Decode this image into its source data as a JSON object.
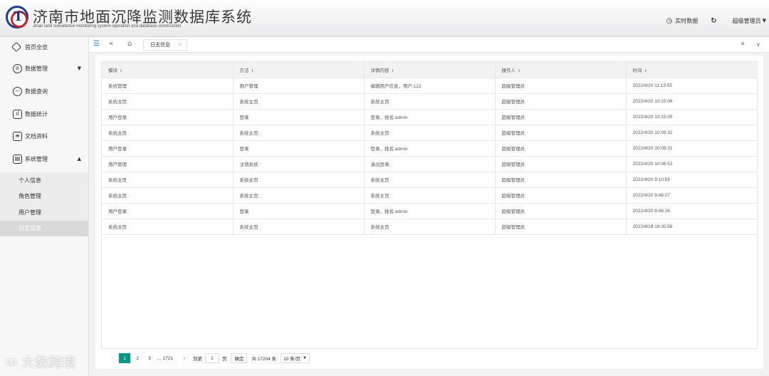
{
  "header": {
    "title": "济南市地面沉降监测数据库系统",
    "subtitle": "Jinan land subsidence monitoring system operation and database construction",
    "realtime_label": "实时数据",
    "user_label": "超级管理员"
  },
  "sidebar": {
    "items": [
      {
        "label": "首页全览",
        "icon": "cube-icon"
      },
      {
        "label": "数据管理",
        "icon": "settings-icon"
      },
      {
        "label": "数据查询",
        "icon": "chart-line-icon"
      },
      {
        "label": "数据统计",
        "icon": "bar-chart-icon"
      },
      {
        "label": "文档资料",
        "icon": "document-icon"
      },
      {
        "label": "系统管理",
        "icon": "system-icon"
      }
    ],
    "sub_items": [
      "个人信息",
      "角色管理",
      "用户管理",
      "日志信息"
    ]
  },
  "tabs": {
    "active_tab": "日志信息"
  },
  "table": {
    "headers": [
      "模块",
      "方法",
      "详情内容",
      "操作人",
      "时间"
    ],
    "rows": [
      [
        "系统管理",
        "用户管理",
        "编辑用户信息，用户:122",
        "超级管理员",
        "2022/4/20 11:13:55"
      ],
      [
        "系统主页",
        "系统主页",
        "系统主页",
        "超级管理员",
        "2022/4/20 10:15:06"
      ],
      [
        "用户登录",
        "登录",
        "登录，姓名:admin",
        "超级管理员",
        "2022/4/20 10:15:05"
      ],
      [
        "系统主页",
        "系统主页",
        "系统主页",
        "超级管理员",
        "2022/4/20 10:08:32"
      ],
      [
        "用户登录",
        "登录",
        "登录，姓名:admin",
        "超级管理员",
        "2022/4/20 10:08:31"
      ],
      [
        "用户管理",
        "注销系统",
        "退出登录:",
        "超级管理员",
        "2022/4/20 10:06:52"
      ],
      [
        "系统主页",
        "系统主页",
        "系统主页",
        "超级管理员",
        "2022/4/20 9:10:59"
      ],
      [
        "系统主页",
        "系统主页",
        "系统主页",
        "超级管理员",
        "2022/4/20 8:48:27"
      ],
      [
        "用户登录",
        "登录",
        "登录，姓名:admin",
        "超级管理员",
        "2022/4/20 8:48:26"
      ],
      [
        "系统主页",
        "系统主页",
        "系统主页",
        "超级管理员",
        "2022/4/19 18:30:56"
      ]
    ]
  },
  "pager": {
    "current": "1",
    "pages": [
      "2",
      "3"
    ],
    "ellipsis": "…",
    "last": "1721",
    "goto_label": "到第",
    "goto_value": "1",
    "page_unit": "页",
    "confirm_label": "确定",
    "total_label": "共 17204 条",
    "page_size_label": "10 条/页"
  },
  "watermark": {
    "text": "大数跨境"
  }
}
